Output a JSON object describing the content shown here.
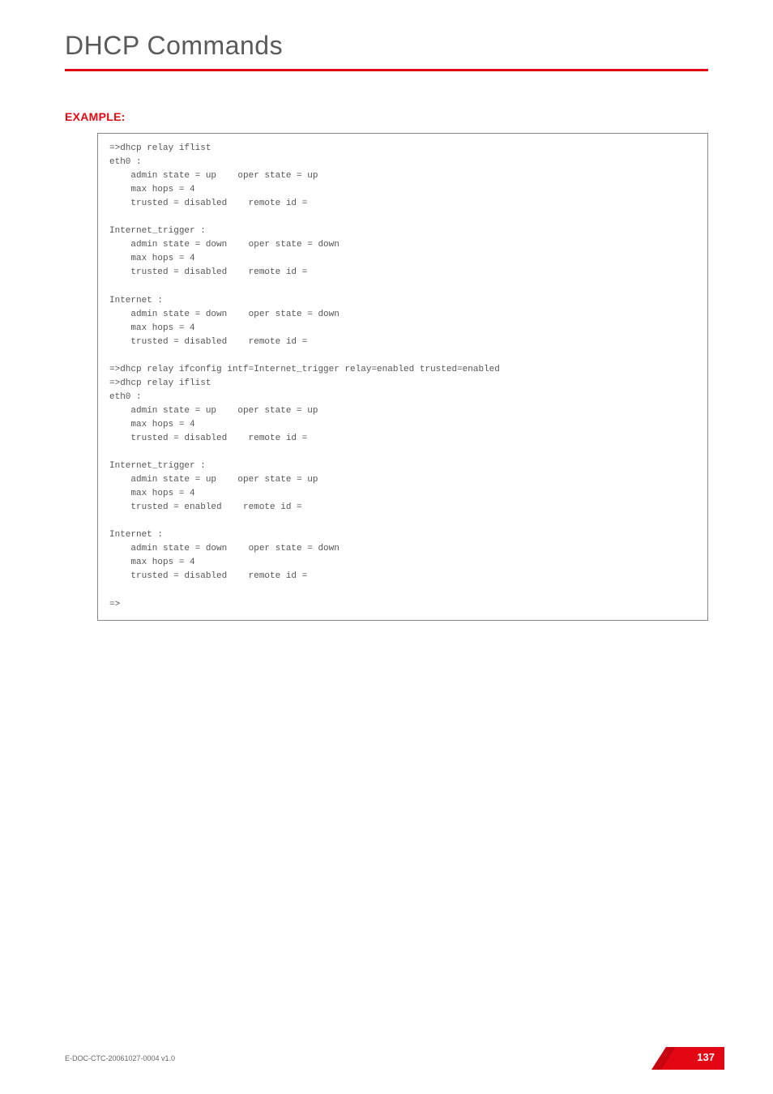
{
  "page_title": "DHCP Commands",
  "section_heading": "EXAMPLE:",
  "code_block": "=>dhcp relay iflist\neth0 :\n    admin state = up    oper state = up\n    max hops = 4\n    trusted = disabled    remote id =\n\nInternet_trigger :\n    admin state = down    oper state = down\n    max hops = 4\n    trusted = disabled    remote id =\n\nInternet :\n    admin state = down    oper state = down\n    max hops = 4\n    trusted = disabled    remote id =\n\n=>dhcp relay ifconfig intf=Internet_trigger relay=enabled trusted=enabled\n=>dhcp relay iflist\neth0 :\n    admin state = up    oper state = up\n    max hops = 4\n    trusted = disabled    remote id =\n\nInternet_trigger :\n    admin state = up    oper state = up\n    max hops = 4\n    trusted = enabled    remote id =\n\nInternet :\n    admin state = down    oper state = down\n    max hops = 4\n    trusted = disabled    remote id =\n\n=>",
  "footer_left": "E-DOC-CTC-20061027-0004 v1.0",
  "page_number": "137"
}
